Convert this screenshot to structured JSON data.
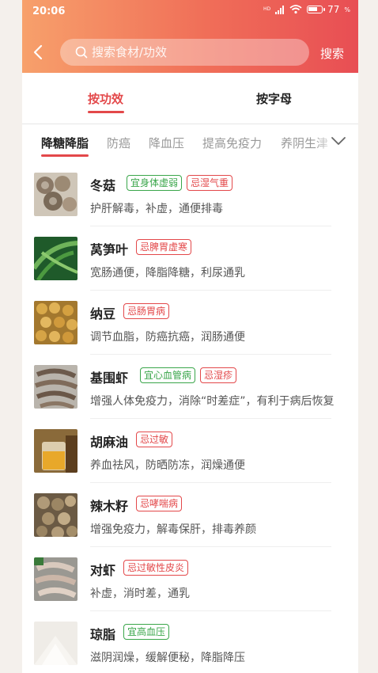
{
  "status_bar": {
    "time": "20:06",
    "signal": "HD",
    "battery": "77",
    "battery_level": 0.77
  },
  "header": {
    "search_placeholder": "搜索食材/功效",
    "search_button": "搜索"
  },
  "tabs": [
    {
      "label": "按功效",
      "active": true
    },
    {
      "label": "按字母",
      "active": false
    }
  ],
  "categories": [
    {
      "label": "降糖降脂",
      "active": true
    },
    {
      "label": "防癌"
    },
    {
      "label": "降血压"
    },
    {
      "label": "提高免疫力"
    },
    {
      "label": "养阴生津"
    }
  ],
  "items": [
    {
      "name": "冬菇",
      "good": [
        "宜身体虚弱"
      ],
      "bad": [
        "忌湿气重"
      ],
      "desc": "护肝解毒，补虚，通便排毒"
    },
    {
      "name": "莴笋叶",
      "good": [],
      "bad": [
        "忌脾胃虚寒"
      ],
      "desc": "宽肠通便，降脂降糖，利尿通乳"
    },
    {
      "name": "纳豆",
      "good": [],
      "bad": [
        "忌肠胃病"
      ],
      "desc": "调节血脂，防癌抗癌，润肠通便"
    },
    {
      "name": "基围虾",
      "good": [
        "宜心血管病"
      ],
      "bad": [
        "忌湿疹"
      ],
      "desc": "增强人体免疫力，消除“时差症”，有利于病后恢复"
    },
    {
      "name": "胡麻油",
      "good": [],
      "bad": [
        "忌过敏"
      ],
      "desc": "养血祛风，防晒防冻，润燥通便"
    },
    {
      "name": "辣木籽",
      "good": [],
      "bad": [
        "忌哮喘病"
      ],
      "desc": "增强免疫力，解毒保肝，排毒养颜"
    },
    {
      "name": "对虾",
      "good": [],
      "bad": [
        "忌过敏性皮炎"
      ],
      "desc": "补虚，消时差，通乳"
    },
    {
      "name": "琼脂",
      "good": [
        "宜高血压"
      ],
      "bad": [],
      "desc": "滋阴润燥，缓解便秘，降脂降压"
    }
  ],
  "colors": {
    "accent": "#e3484a",
    "good_tag": "#3aa64a",
    "header_start": "#f7a06b",
    "header_end": "#e84e54"
  },
  "icons": [
    "back-arrow-icon",
    "search-icon",
    "chevron-down-icon",
    "wifi-icon",
    "signal-icon",
    "battery-icon"
  ]
}
